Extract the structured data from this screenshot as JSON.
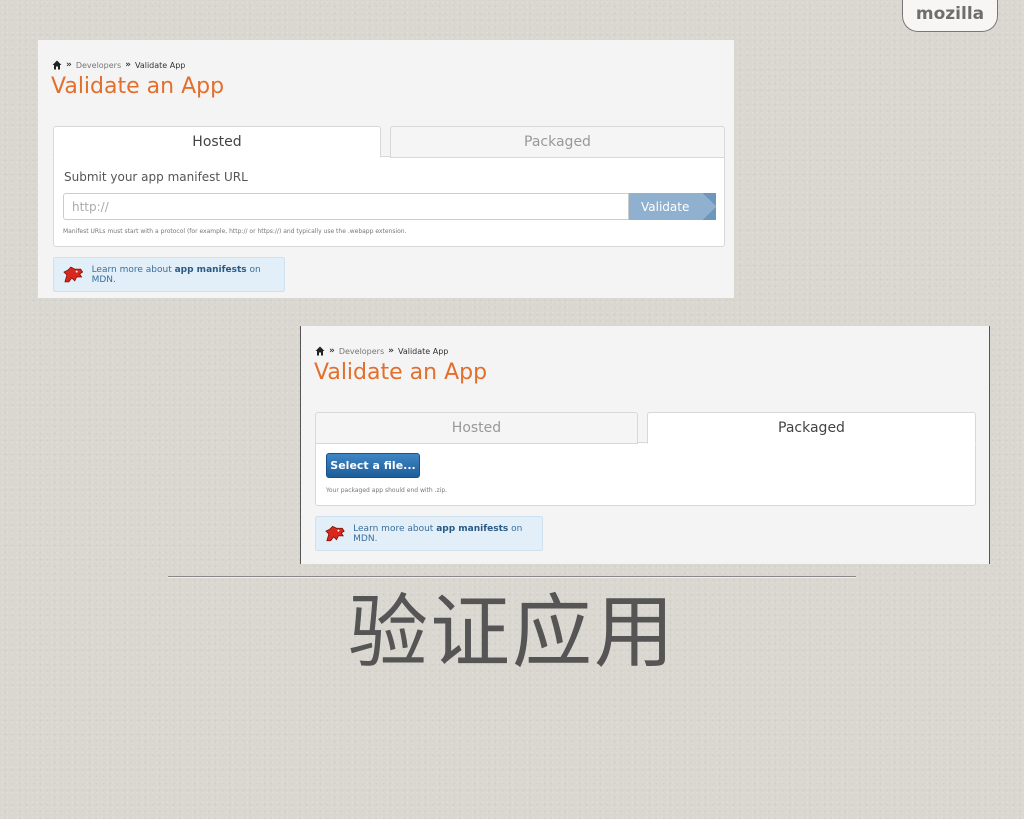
{
  "brand": {
    "name": "mozilla"
  },
  "screenshots": [
    {
      "breadcrumb": {
        "home_icon": "home-icon",
        "sep": "»",
        "developers": "Developers",
        "current": "Validate App"
      },
      "title": "Validate an App",
      "tabs": [
        {
          "label": "Hosted",
          "active": true
        },
        {
          "label": "Packaged",
          "active": false
        }
      ],
      "field_label": "Submit your app manifest URL",
      "url_input": {
        "value": "",
        "placeholder": "http://"
      },
      "validate_button": "Validate",
      "help_text": "Manifest URLs must start with a protocol (for example, http:// or https://) and typically use the .webapp extension.",
      "mdn": {
        "pre": "Learn more about",
        "link": "app manifests",
        "post": "on MDN."
      }
    },
    {
      "breadcrumb": {
        "home_icon": "home-icon",
        "sep": "»",
        "developers": "Developers",
        "current": "Validate App"
      },
      "title": "Validate an App",
      "tabs": [
        {
          "label": "Hosted",
          "active": false
        },
        {
          "label": "Packaged",
          "active": true
        }
      ],
      "select_button": "Select a file...",
      "help_text": "Your packaged app should end with .zip.",
      "mdn": {
        "pre": "Learn more about",
        "link": "app manifests",
        "post": "on MDN."
      }
    }
  ],
  "slide_title": "验证应用",
  "colors": {
    "accent_orange": "#e36f2c",
    "validate_blue": "#8fb1cf",
    "button_blue": "#2a6fad",
    "info_bg": "#e2eff9"
  }
}
